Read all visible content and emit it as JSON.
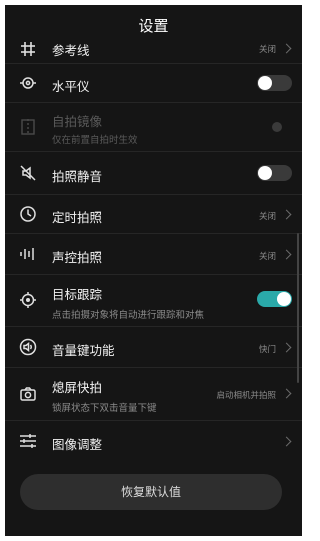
{
  "header": {
    "title": "设置"
  },
  "settings": [
    {
      "label": "参考线",
      "value": "关闭"
    },
    {
      "label": "水平仪"
    },
    {
      "label": "自拍镜像",
      "sub": "仅在前置自拍时生效"
    },
    {
      "label": "拍照静音"
    },
    {
      "label": "定时拍照",
      "value": "关闭"
    },
    {
      "label": "声控拍照",
      "value": "关闭"
    },
    {
      "label": "目标跟踪",
      "sub": "点击拍摄对象将自动进行跟踪和对焦"
    },
    {
      "label": "音量键功能",
      "value": "快门"
    },
    {
      "label": "熄屏快拍",
      "sub": "锁屏状态下双击音量下键",
      "value": "启动相机并拍照"
    },
    {
      "label": "图像调整"
    }
  ],
  "toggles": {
    "level": false,
    "mirror": false,
    "mute": false,
    "tracking": true
  },
  "footer": {
    "reset_label": "恢复默认值"
  },
  "colors": {
    "background": "#151515",
    "accent": "#2aa9a9"
  }
}
